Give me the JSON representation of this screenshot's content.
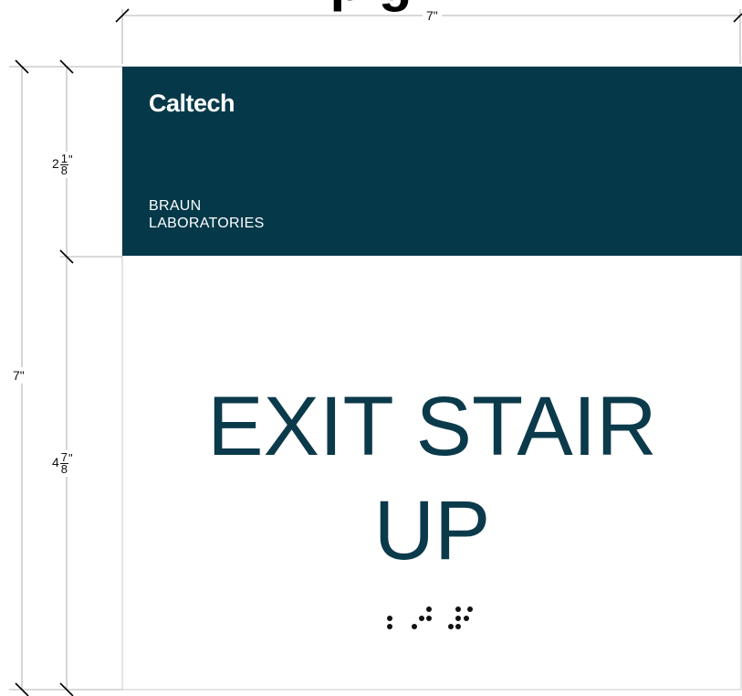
{
  "header_title_partial": "p         g",
  "dimensions": {
    "width_label": "7\"",
    "height_total_label": "7\"",
    "header_height": {
      "whole": "2",
      "num": "1",
      "den": "8",
      "unit": "\""
    },
    "body_height": {
      "whole": "4",
      "num": "7",
      "den": "8",
      "unit": "\""
    }
  },
  "sign": {
    "brand": "Caltech",
    "building_line1": "BRAUN",
    "building_line2": "LABORATORIES",
    "message_line1": "EXIT STAIR",
    "message_line2": "UP",
    "header_color": "#05394a",
    "text_color": "#0b3a4b"
  },
  "braille": {
    "description_icon": "braille-dots"
  }
}
